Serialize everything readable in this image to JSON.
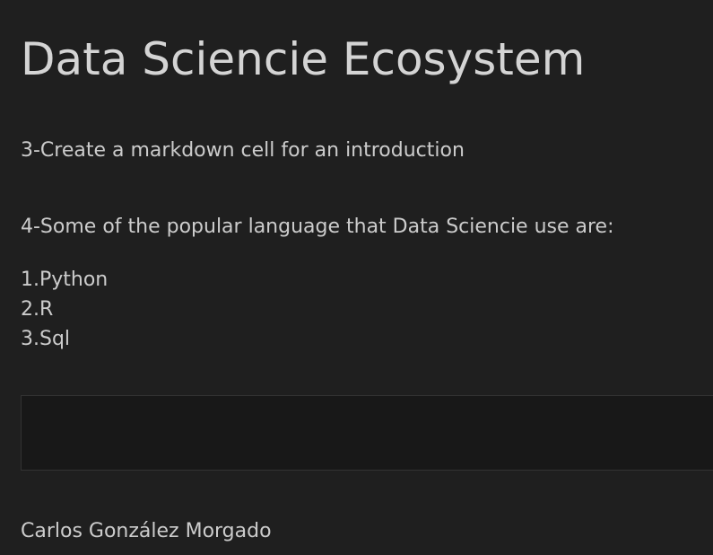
{
  "notebook": {
    "title": "Data Sciencie Ecosystem",
    "intro": "3-Create a markdown cell for an introduction",
    "languages_heading": "4-Some of the popular language that Data Sciencie use are:",
    "languages": [
      "1.Python",
      "2.R",
      "3.Sql"
    ],
    "code_cell": "",
    "author": "Carlos González Morgado"
  },
  "colors": {
    "background": "#1f1f1f",
    "text": "#cccccc",
    "code_cell_background": "#181818",
    "code_cell_border": "#333333"
  }
}
